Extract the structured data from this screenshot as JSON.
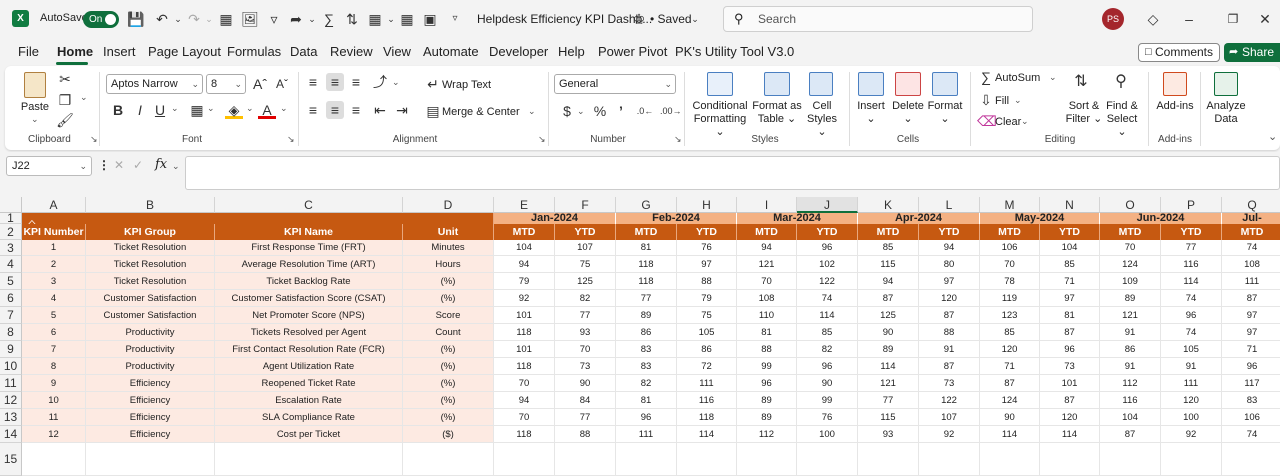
{
  "titlebar": {
    "autosave_label": "AutoSave",
    "autosave_state": "On",
    "doc_title": "Helpdesk Efficiency KPI Dashb...",
    "saved_status": "• Saved",
    "search_placeholder": "Search",
    "user_initials": "PS"
  },
  "menu": {
    "tabs": [
      "File",
      "Home",
      "Insert",
      "Page Layout",
      "Formulas",
      "Data",
      "Review",
      "View",
      "Automate",
      "Developer",
      "Help",
      "Power Pivot",
      "PK's Utility Tool V3.0"
    ],
    "active_tab": "Home",
    "comments_label": "Comments",
    "share_label": "Share"
  },
  "ribbon": {
    "clipboard": {
      "paste": "Paste",
      "group": "Clipboard"
    },
    "font": {
      "name": "Aptos Narrow",
      "size": "8",
      "group": "Font"
    },
    "alignment": {
      "wrap": "Wrap Text",
      "merge": "Merge & Center",
      "group": "Alignment"
    },
    "number": {
      "format": "General",
      "group": "Number"
    },
    "styles": {
      "conditional": [
        "Conditional",
        "Formatting"
      ],
      "format_table": [
        "Format as",
        "Table"
      ],
      "cell_styles": [
        "Cell",
        "Styles"
      ],
      "group": "Styles"
    },
    "cells": {
      "insert": "Insert",
      "delete": "Delete",
      "format": "Format",
      "group": "Cells"
    },
    "editing": {
      "autosum": "AutoSum",
      "fill": "Fill",
      "clear": "Clear",
      "sort": [
        "Sort &",
        "Filter"
      ],
      "find": [
        "Find &",
        "Select"
      ],
      "group": "Editing"
    },
    "addins": {
      "label": "Add-ins",
      "group": "Add-ins"
    },
    "analyze": {
      "label": [
        "Analyze",
        "Data"
      ]
    }
  },
  "formula_bar": {
    "name_box": "J22",
    "fx": "fx",
    "value": ""
  },
  "sheet": {
    "columns": [
      "A",
      "B",
      "C",
      "D",
      "E",
      "F",
      "G",
      "H",
      "I",
      "J",
      "K",
      "L",
      "M",
      "N",
      "O",
      "P",
      "Q"
    ],
    "selected_column": "J",
    "row_numbers": [
      "1",
      "2",
      "3",
      "4",
      "5",
      "6",
      "7",
      "8",
      "9",
      "10",
      "11",
      "12",
      "13",
      "14",
      "15"
    ],
    "header_row": [
      "KPI Number",
      "KPI Group",
      "KPI Name",
      "Unit"
    ],
    "months": [
      "Jan-2024",
      "Feb-2024",
      "Mar-2024",
      "Apr-2024",
      "May-2024",
      "Jun-2024",
      "Jul-"
    ],
    "mtd_label": "MTD",
    "ytd_label": "YTD",
    "rows": [
      {
        "num": "1",
        "group": "Ticket Resolution",
        "name": "First Response Time (FRT)",
        "unit": "Minutes",
        "vals": [
          "104",
          "107",
          "81",
          "76",
          "94",
          "96",
          "85",
          "94",
          "106",
          "104",
          "70",
          "77",
          "74"
        ]
      },
      {
        "num": "2",
        "group": "Ticket Resolution",
        "name": "Average Resolution Time (ART)",
        "unit": "Hours",
        "vals": [
          "94",
          "75",
          "118",
          "97",
          "121",
          "102",
          "115",
          "80",
          "70",
          "85",
          "124",
          "116",
          "108"
        ]
      },
      {
        "num": "3",
        "group": "Ticket Resolution",
        "name": "Ticket Backlog Rate",
        "unit": "(%)",
        "vals": [
          "79",
          "125",
          "118",
          "88",
          "70",
          "122",
          "94",
          "97",
          "78",
          "71",
          "109",
          "114",
          "111"
        ]
      },
      {
        "num": "4",
        "group": "Customer Satisfaction",
        "name": "Customer Satisfaction Score (CSAT)",
        "unit": "(%)",
        "vals": [
          "92",
          "82",
          "77",
          "79",
          "108",
          "74",
          "87",
          "120",
          "119",
          "97",
          "89",
          "74",
          "87"
        ]
      },
      {
        "num": "5",
        "group": "Customer Satisfaction",
        "name": "Net Promoter Score (NPS)",
        "unit": "Score",
        "vals": [
          "101",
          "77",
          "89",
          "75",
          "110",
          "114",
          "125",
          "87",
          "123",
          "81",
          "121",
          "96",
          "97"
        ]
      },
      {
        "num": "6",
        "group": "Productivity",
        "name": "Tickets Resolved per Agent",
        "unit": "Count",
        "vals": [
          "118",
          "93",
          "86",
          "105",
          "81",
          "85",
          "90",
          "88",
          "85",
          "87",
          "91",
          "74",
          "97"
        ]
      },
      {
        "num": "7",
        "group": "Productivity",
        "name": "First Contact Resolution Rate (FCR)",
        "unit": "(%)",
        "vals": [
          "101",
          "70",
          "83",
          "86",
          "88",
          "82",
          "89",
          "91",
          "120",
          "96",
          "86",
          "105",
          "71"
        ]
      },
      {
        "num": "8",
        "group": "Productivity",
        "name": "Agent Utilization Rate",
        "unit": "(%)",
        "vals": [
          "118",
          "73",
          "83",
          "72",
          "99",
          "96",
          "114",
          "87",
          "71",
          "73",
          "91",
          "91",
          "96"
        ]
      },
      {
        "num": "9",
        "group": "Efficiency",
        "name": "Reopened Ticket Rate",
        "unit": "(%)",
        "vals": [
          "70",
          "90",
          "82",
          "111",
          "96",
          "90",
          "121",
          "73",
          "87",
          "101",
          "112",
          "111",
          "117"
        ]
      },
      {
        "num": "10",
        "group": "Efficiency",
        "name": "Escalation Rate",
        "unit": "(%)",
        "vals": [
          "94",
          "84",
          "81",
          "116",
          "89",
          "99",
          "77",
          "122",
          "124",
          "87",
          "116",
          "120",
          "83"
        ]
      },
      {
        "num": "11",
        "group": "Efficiency",
        "name": "SLA Compliance Rate",
        "unit": "(%)",
        "vals": [
          "70",
          "77",
          "96",
          "118",
          "89",
          "76",
          "115",
          "107",
          "90",
          "120",
          "104",
          "100",
          "106"
        ]
      },
      {
        "num": "12",
        "group": "Efficiency",
        "name": "Cost per Ticket",
        "unit": "($)",
        "vals": [
          "118",
          "88",
          "111",
          "114",
          "112",
          "100",
          "93",
          "92",
          "114",
          "114",
          "87",
          "92",
          "74"
        ]
      }
    ]
  },
  "colors": {
    "accent": "#c65911",
    "month_header": "#f4b183",
    "pink_fill": "#fdeae2",
    "excel_green": "#0f6f3c"
  }
}
